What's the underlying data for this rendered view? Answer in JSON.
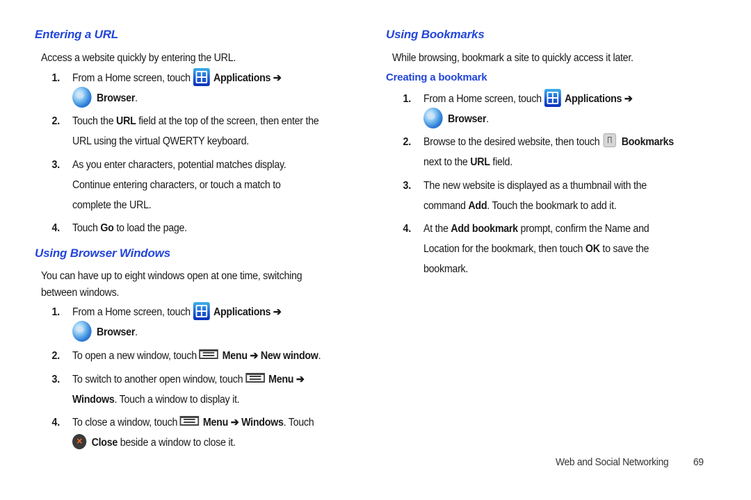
{
  "left": {
    "entering_url": {
      "heading": "Entering a URL",
      "intro": "Access a website quickly by entering the URL.",
      "steps": [
        {
          "num": "1.",
          "a": "From a Home screen, touch",
          "b": "Applications ➔",
          "c": "Browser",
          "d": "."
        },
        {
          "num": "2.",
          "a": "Touch the ",
          "b": "URL",
          "c": " field at the top of the screen, then enter the",
          "line2": "URL using the virtual QWERTY keyboard."
        },
        {
          "num": "3.",
          "line1": "As you enter characters, potential matches display.",
          "line2": "Continue entering characters, or touch a match to",
          "line3": "complete the URL."
        },
        {
          "num": "4.",
          "a": "Touch ",
          "b": "Go",
          "c": " to load the page."
        }
      ]
    },
    "browser_windows": {
      "heading": "Using Browser Windows",
      "intro_line1": "You can have up to eight windows open at one time, switching",
      "intro_line2": "between windows.",
      "steps": [
        {
          "num": "1.",
          "a": "From a Home screen, touch",
          "b": "Applications ➔",
          "c": "Browser",
          "d": "."
        },
        {
          "num": "2.",
          "a": "To open a new window, touch",
          "b": "Menu ➔ New window",
          "c": "."
        },
        {
          "num": "3.",
          "a": "To switch to another open window, touch",
          "b": "Menu ➔",
          "c": "Windows",
          "d": ". Touch a window to display it."
        },
        {
          "num": "4.",
          "a": "To close a window, touch",
          "b": "Menu ➔ Windows",
          "c": ". Touch",
          "d": "Close",
          "e": " beside a window to close it."
        }
      ]
    }
  },
  "right": {
    "bookmarks": {
      "heading": "Using Bookmarks",
      "intro": "While browsing, bookmark a site to quickly access it later.",
      "subheading": "Creating a bookmark",
      "steps": [
        {
          "num": "1.",
          "a": "From a Home screen, touch",
          "b": "Applications ➔",
          "c": "Browser",
          "d": "."
        },
        {
          "num": "2.",
          "a": "Browse to the desired website, then touch",
          "b": "Bookmarks",
          "c": "next to the ",
          "d": "URL",
          "e": " field."
        },
        {
          "num": "3.",
          "line1": "The new website is displayed as a thumbnail with the",
          "a": "command ",
          "b": "Add",
          "c": ". Touch the bookmark to add it."
        },
        {
          "num": "4.",
          "a": "At the ",
          "b": "Add bookmark",
          "c": " prompt, confirm the Name and",
          "d": "Location for the bookmark, then touch ",
          "e": "OK",
          "f": " to save the",
          "g": "bookmark."
        }
      ]
    }
  },
  "footer": {
    "section": "Web and Social Networking",
    "page": "69"
  },
  "colors": {
    "heading": "#2346d9",
    "text": "#1a1a1a"
  }
}
